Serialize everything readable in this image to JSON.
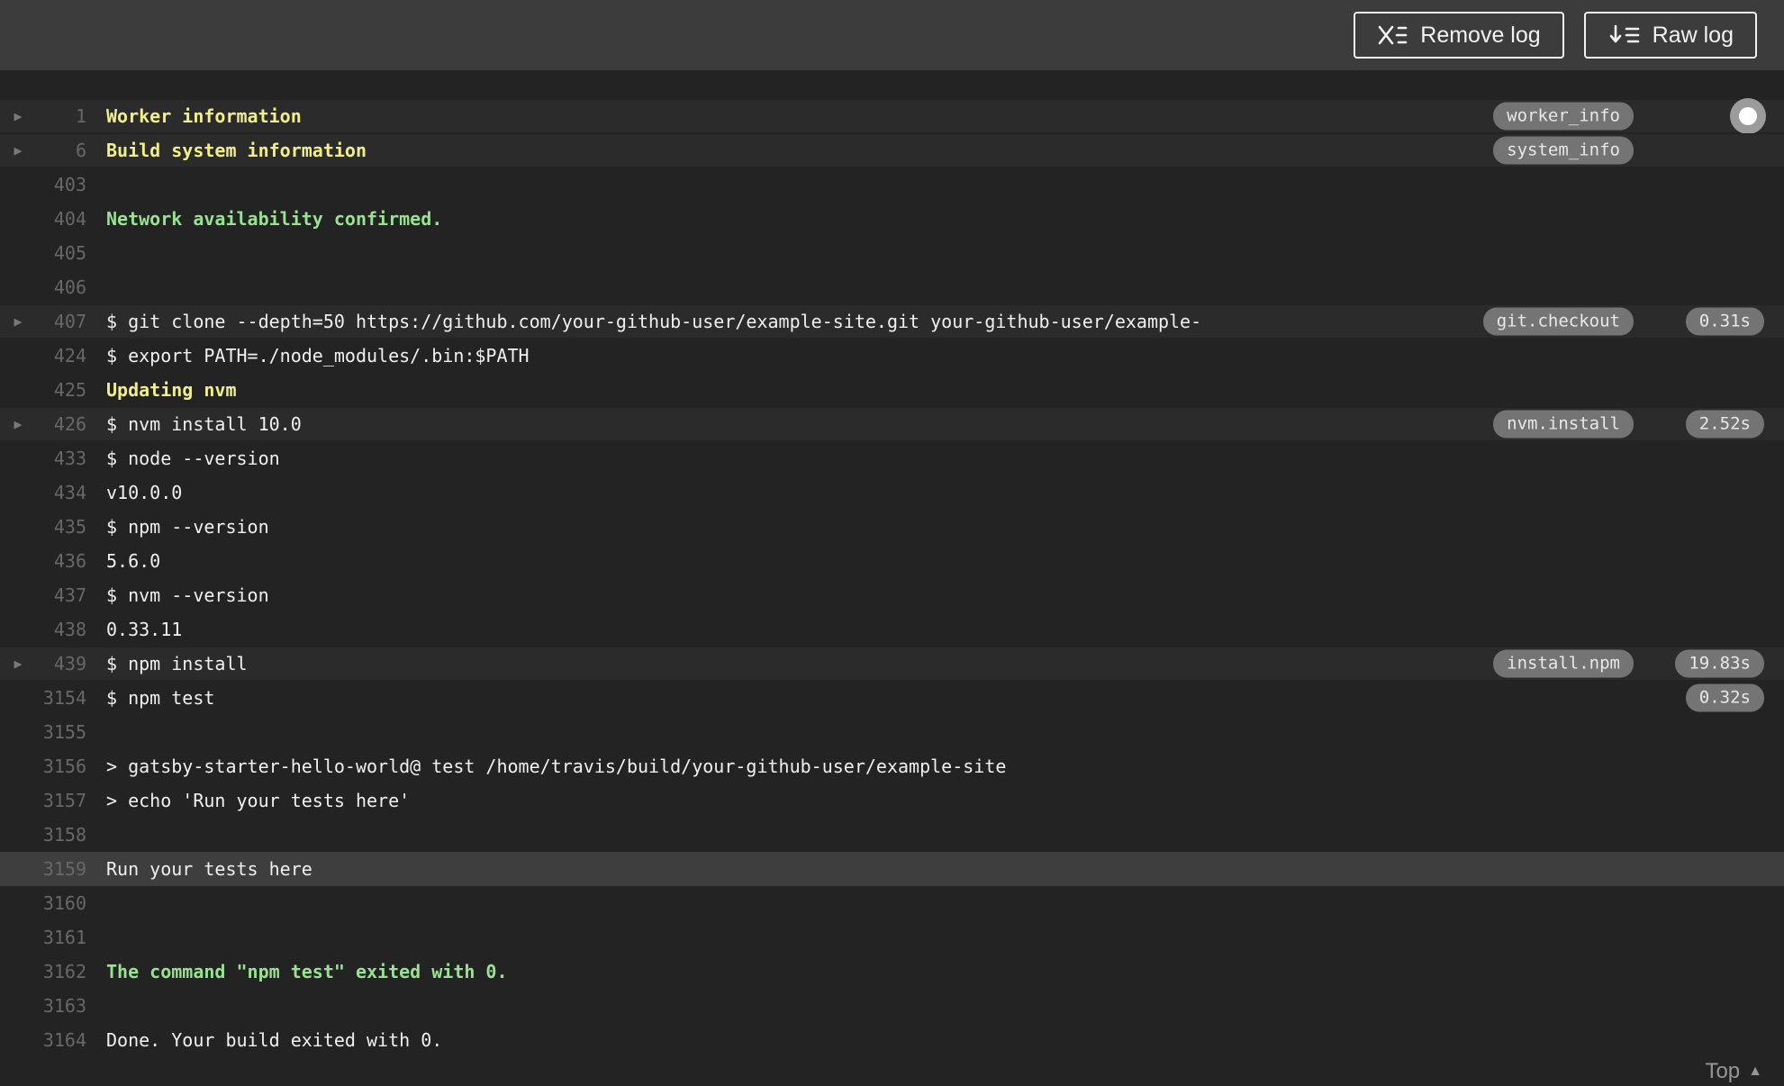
{
  "toolbar": {
    "remove_log_label": "Remove log",
    "raw_log_label": "Raw log"
  },
  "colors": {
    "header_bg": "#3c3c3c",
    "log_bg": "#232323",
    "fold_row_bg": "#2b2b2b",
    "highlight_row_bg": "#3e3e3e",
    "text": "#f0f0f0",
    "ansi_yellow": "#f2ef87",
    "ansi_green": "#98e292",
    "line_number": "#686868",
    "badge_bg": "#747474",
    "badge_text": "#e8e8e8"
  },
  "icons": {
    "remove_log": "x-with-list-icon",
    "raw_log": "down-arrow-with-list-icon",
    "fold": "right-triangle-icon",
    "top": "up-triangle-icon",
    "scroll_indicator": "circle-dot-icon"
  },
  "log": {
    "lines": [
      {
        "number": "1",
        "text": "Worker information",
        "style": "yellow",
        "fold": true,
        "row_bg": "fold",
        "badge": "worker_info",
        "indicator": true
      },
      {
        "number": "6",
        "text": "Build system information",
        "style": "yellow",
        "fold": true,
        "row_bg": "fold",
        "badge": "system_info"
      },
      {
        "number": "403",
        "text": ""
      },
      {
        "number": "404",
        "text": "Network availability confirmed.",
        "style": "green"
      },
      {
        "number": "405",
        "text": ""
      },
      {
        "number": "406",
        "text": ""
      },
      {
        "number": "407",
        "text": "$ git clone --depth=50 https://github.com/your-github-user/example-site.git your-github-user/example-",
        "fold": true,
        "row_bg": "fold",
        "badge": "git.checkout",
        "duration": "0.31s"
      },
      {
        "number": "424",
        "text": "$ export PATH=./node_modules/.bin:$PATH"
      },
      {
        "number": "425",
        "text": "Updating nvm",
        "style": "yellow"
      },
      {
        "number": "426",
        "text": "$ nvm install 10.0",
        "fold": true,
        "row_bg": "fold",
        "badge": "nvm.install",
        "duration": "2.52s"
      },
      {
        "number": "433",
        "text": "$ node --version"
      },
      {
        "number": "434",
        "text": "v10.0.0"
      },
      {
        "number": "435",
        "text": "$ npm --version"
      },
      {
        "number": "436",
        "text": "5.6.0"
      },
      {
        "number": "437",
        "text": "$ nvm --version"
      },
      {
        "number": "438",
        "text": "0.33.11"
      },
      {
        "number": "439",
        "text": "$ npm install",
        "fold": true,
        "row_bg": "fold",
        "badge": "install.npm",
        "duration": "19.83s"
      },
      {
        "number": "3154",
        "text": "$ npm test",
        "duration": "0.32s"
      },
      {
        "number": "3155",
        "text": ""
      },
      {
        "number": "3156",
        "text": "> gatsby-starter-hello-world@ test /home/travis/build/your-github-user/example-site"
      },
      {
        "number": "3157",
        "text": "> echo 'Run your tests here'"
      },
      {
        "number": "3158",
        "text": ""
      },
      {
        "number": "3159",
        "text": "Run your tests here",
        "row_bg": "highlight"
      },
      {
        "number": "3160",
        "text": ""
      },
      {
        "number": "3161",
        "text": ""
      },
      {
        "number": "3162",
        "text": "The command \"npm test\" exited with 0.",
        "style": "green"
      },
      {
        "number": "3163",
        "text": ""
      },
      {
        "number": "3164",
        "text": "Done. Your build exited with 0."
      }
    ]
  },
  "footer": {
    "top_label": "Top"
  }
}
